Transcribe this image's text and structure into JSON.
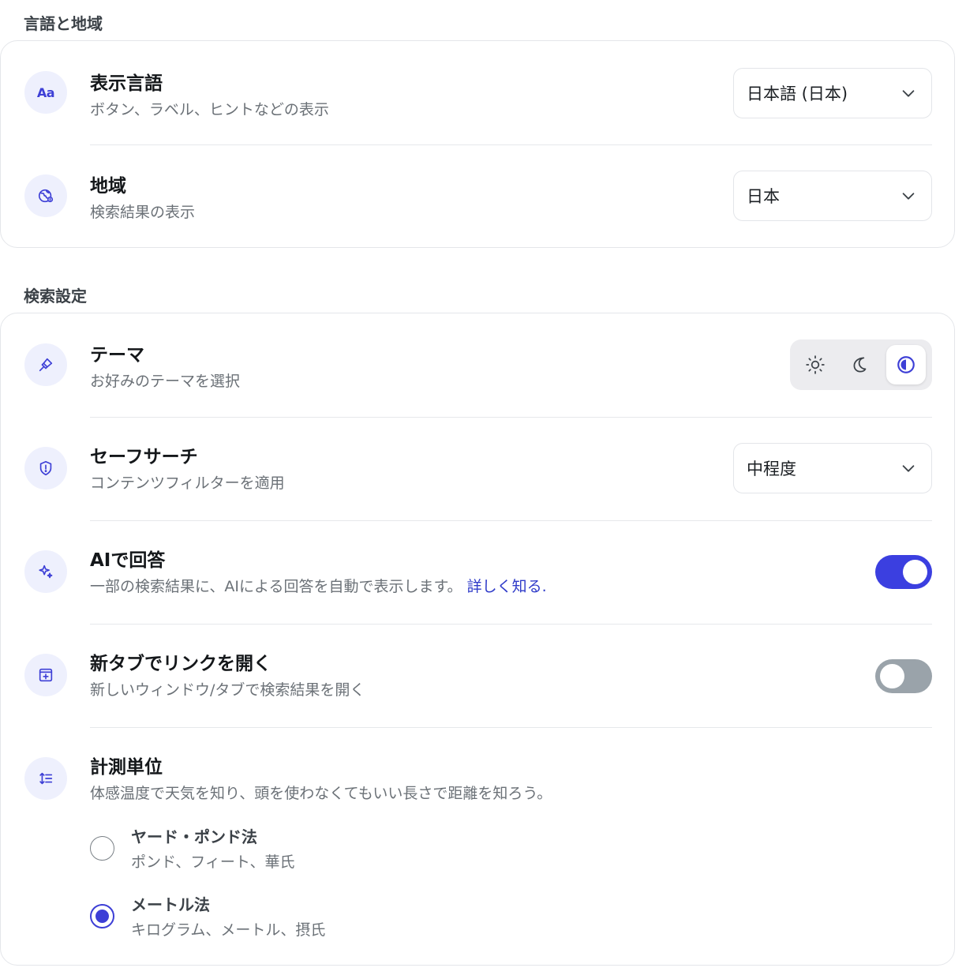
{
  "sections": {
    "language_region": {
      "title": "言語と地域",
      "display_language": {
        "title": "表示言語",
        "description": "ボタン、ラベル、ヒントなどの表示",
        "icon": "Aa",
        "selected": "日本語 (日本)"
      },
      "region": {
        "title": "地域",
        "description": "検索結果の表示",
        "icon": "globe-icon",
        "selected": "日本"
      }
    },
    "search_settings": {
      "title": "検索設定",
      "theme": {
        "title": "テーマ",
        "description": "お好みのテーマを選択",
        "icon": "paintbrush-icon",
        "options": [
          "light",
          "dark",
          "system"
        ],
        "selected": "system"
      },
      "safe_search": {
        "title": "セーフサーチ",
        "description": "コンテンツフィルターを適用",
        "icon": "shield-icon",
        "selected": "中程度"
      },
      "ai_answers": {
        "title": "AIで回答",
        "description": "一部の検索結果に、AIによる回答を自動で表示します。",
        "link": "詳しく知る.",
        "icon": "sparkle-icon",
        "enabled": true
      },
      "new_tab": {
        "title": "新タブでリンクを開く",
        "description": "新しいウィンドウ/タブで検索結果を開く",
        "icon": "new-window-icon",
        "enabled": false
      },
      "units": {
        "title": "計測単位",
        "description": "体感温度で天気を知り、頭を使わなくてもいい長さで距離を知ろう。",
        "icon": "units-icon",
        "options": [
          {
            "title": "ヤード・ポンド法",
            "description": "ポンド、フィート、華氏",
            "checked": false
          },
          {
            "title": "メートル法",
            "description": "キログラム、メートル、摂氏",
            "checked": true
          }
        ]
      }
    }
  },
  "colors": {
    "accent": "#3d3fd6",
    "toggle_on": "#3b3fe0",
    "toggle_off": "#9aa3aa",
    "icon_bg": "#eef0fd"
  }
}
